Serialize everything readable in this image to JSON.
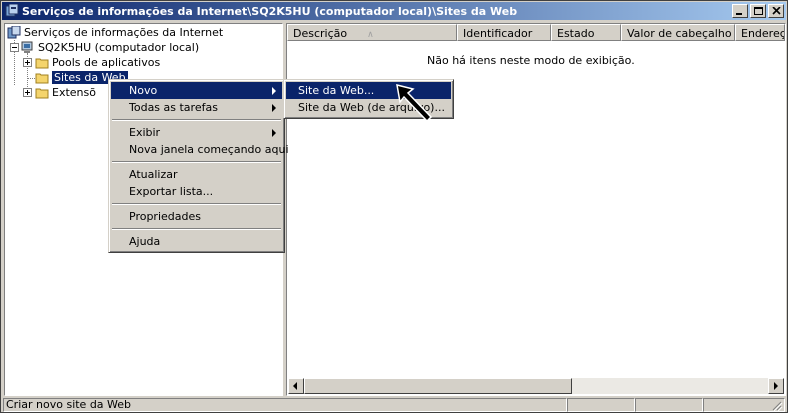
{
  "window": {
    "title": "Serviços de informações da Internet\\SQ2K5HU (computador local)\\Sites da Web"
  },
  "tree": {
    "root": "Serviços de informações da Internet",
    "server": "SQ2K5HU (computador local)",
    "app_pools": "Pools de aplicativos",
    "web_sites": "Sites da Web",
    "extensions": "Extensõ"
  },
  "list": {
    "columns": [
      "Descrição",
      "Identificador",
      "Estado",
      "Valor de cabeçalho ...",
      "Endereç"
    ],
    "sort_indicator": "∧",
    "empty_message": "Não há itens neste modo de exibição."
  },
  "context_menu": {
    "items": [
      {
        "label": "Novo",
        "submenu": true,
        "highlighted": true
      },
      {
        "label": "Todas as tarefas",
        "submenu": true
      },
      {
        "label": "Exibir",
        "submenu": true
      },
      {
        "label": "Nova janela começando aqui"
      },
      {
        "label": "Atualizar"
      },
      {
        "label": "Exportar lista..."
      },
      {
        "label": "Propriedades"
      },
      {
        "label": "Ajuda"
      }
    ]
  },
  "submenu": {
    "items": [
      {
        "label": "Site da Web...",
        "highlighted": true
      },
      {
        "label": "Site da Web (de arquivo)..."
      }
    ]
  },
  "status": {
    "text": "Criar novo site da Web"
  },
  "colors": {
    "title_start": "#0a246a",
    "title_end": "#a6caf0",
    "selection": "#0a246a",
    "face": "#d4d0c8"
  }
}
